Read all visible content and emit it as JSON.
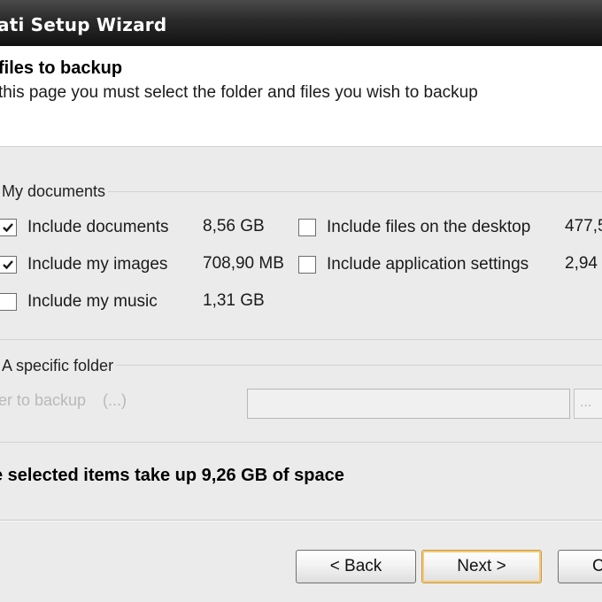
{
  "window": {
    "title": "ati Setup Wizard"
  },
  "header": {
    "title": "files to backup",
    "subtitle": "this page you must select the folder and files you wish to backup"
  },
  "my_documents": {
    "group_label": "My documents",
    "items": [
      {
        "label": "Include documents",
        "size": "8,56 GB",
        "checked": true
      },
      {
        "label": "Include my images",
        "size": "708,90 MB",
        "checked": true
      },
      {
        "label": "Include my music",
        "size": "1,31 GB",
        "checked": false
      },
      {
        "label": "Include files on the desktop",
        "size": "477,5",
        "checked": false
      },
      {
        "label": "Include application settings",
        "size": "2,94",
        "checked": false
      }
    ]
  },
  "specific_folder": {
    "group_label": "A specific folder",
    "field_label": "er to backup",
    "field_hint": "(...)",
    "field_value": "",
    "browse_label": "..."
  },
  "summary": "e selected items take up 9,26 GB of space",
  "buttons": {
    "back": "< Back",
    "next": "Next >",
    "cancel": "C"
  }
}
